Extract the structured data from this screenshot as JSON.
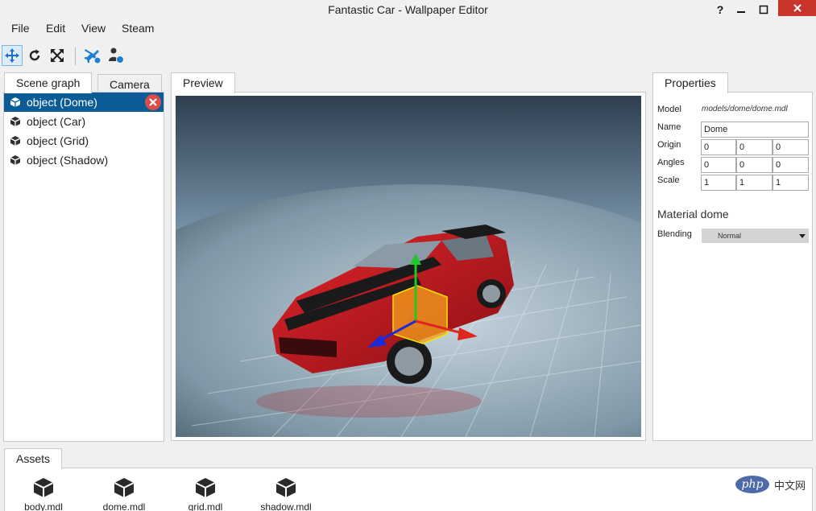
{
  "window": {
    "title": "Fantastic Car - Wallpaper Editor",
    "help": "?",
    "minimize": "—",
    "maximize": "□",
    "close": "✕"
  },
  "menu": {
    "file": "File",
    "edit": "Edit",
    "view": "View",
    "steam": "Steam"
  },
  "toolbar": {
    "icons": [
      "move-icon",
      "rotate-icon",
      "scale-icon",
      "preview-plane-icon",
      "workshop-user-icon"
    ]
  },
  "scene": {
    "tabs": {
      "scene_graph": "Scene graph",
      "camera": "Camera"
    },
    "items": [
      {
        "label": "object (Dome)",
        "selected": true
      },
      {
        "label": "object (Car)"
      },
      {
        "label": "object (Grid)"
      },
      {
        "label": "object (Shadow)"
      }
    ]
  },
  "preview": {
    "tab": "Preview"
  },
  "properties": {
    "tab": "Properties",
    "model_label": "Model",
    "model_value": "models/dome/dome.mdl",
    "name_label": "Name",
    "name_value": "Dome",
    "origin_label": "Origin",
    "origin": [
      "0",
      "0",
      "0"
    ],
    "angles_label": "Angles",
    "angles": [
      "0",
      "0",
      "0"
    ],
    "scale_label": "Scale",
    "scale": [
      "1",
      "1",
      "1"
    ],
    "material_heading": "Material dome",
    "blending_label": "Blending",
    "blending_value": "Normal"
  },
  "assets": {
    "tab": "Assets",
    "items": [
      "body.mdl",
      "dome.mdl",
      "grid.mdl",
      "shadow.mdl"
    ]
  },
  "watermark": {
    "logo": "php",
    "text": "中文网"
  },
  "colors": {
    "selection": "#0b5c96",
    "close": "#c7352b",
    "accent_blue": "#1f7fd1"
  }
}
